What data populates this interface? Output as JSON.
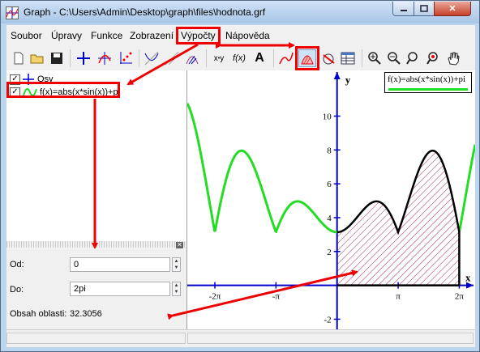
{
  "window": {
    "title": "Graph - C:\\Users\\Admin\\Desktop\\graph\\files\\hodnota.grf",
    "minimize_icon": "minimize-icon",
    "maximize_icon": "maximize-icon",
    "close_glyph": "✕"
  },
  "menu": {
    "items": [
      "Soubor",
      "Úpravy",
      "Funkce",
      "Zobrazení",
      "Výpočty",
      "Nápověda"
    ]
  },
  "toolbar": {
    "items": [
      "new-file-icon",
      "open-folder-icon",
      "save-icon",
      "insert-axes-icon",
      "insert-function-icon",
      "point-series-icon",
      "tangent-icon",
      "shading-icon",
      "relation-icon",
      "evaluate-icon",
      "fx-icon",
      "text-label-icon",
      "trendline-icon",
      "area-icon",
      "animate-icon",
      "table-icon",
      "zoom-in-icon",
      "zoom-out-icon",
      "zoom-fit-icon",
      "zoom-square-icon",
      "pan-hand-icon"
    ]
  },
  "tree": {
    "axes_label": "Osy",
    "function_label": "f(x)=abs(x*sin(x))+pi"
  },
  "calc": {
    "from_label": "Od:",
    "from_value": "0",
    "to_label": "Do:",
    "to_value": "2pi",
    "area_label": "Obsah oblasti:",
    "area_value": "32.3056"
  },
  "graph": {
    "legend": "f(x)=abs(x*sin(x))+pi",
    "x_axis_label": "x",
    "y_axis_label": "y",
    "x_ticks": [
      "-2π",
      "-π",
      "π",
      "2π"
    ],
    "y_ticks": [
      "10",
      "8",
      "6",
      "4",
      "2",
      "-2"
    ],
    "curve_color": "#22dd22",
    "area_curve_color": "#000000",
    "hatch_color": "#a0306a",
    "axis_color": "#0000cc"
  },
  "chart_data": {
    "type": "line",
    "function": "f(x)=abs(x*sin(x))+pi",
    "xlabel": "x",
    "ylabel": "y",
    "xlim": [
      -7.7,
      7.1
    ],
    "ylim": [
      -2.6,
      12.7
    ],
    "x_tick_labels": [
      "-2π",
      "-π",
      "π",
      "2π"
    ],
    "y_tick_labels": [
      "-2",
      "2",
      "4",
      "6",
      "8",
      "10"
    ],
    "shaded_interval": [
      0,
      6.2832
    ],
    "shaded_area": 32.3056
  },
  "annotations": {
    "highlight_color": "#ee0000"
  }
}
